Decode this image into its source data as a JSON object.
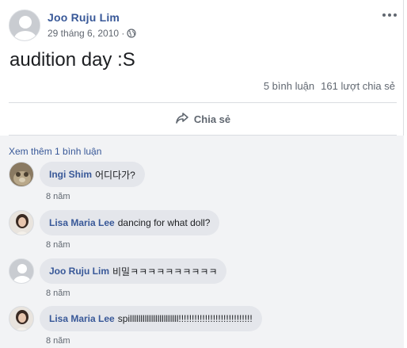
{
  "post": {
    "author": "Joo Ruju Lim",
    "date": "29 tháng 6, 2010 ·",
    "privacy_icon": "globe-icon",
    "text": "audition day :S",
    "stats": {
      "comments": "5 bình luận",
      "shares": "161 lượt chia sẻ"
    },
    "share_label": "Chia sẻ"
  },
  "comments": {
    "view_more": "Xem thêm 1 bình luận",
    "items": [
      {
        "name": "Ingi Shim",
        "text": "어디다가?",
        "time": "8 năm"
      },
      {
        "name": "Lisa Maria Lee",
        "text": "dancing for what doll?",
        "time": "8 năm"
      },
      {
        "name": "Joo Ruju Lim",
        "text": "비밀ㅋㅋㅋㅋㅋㅋㅋㅋㅋㅋ",
        "time": "8 năm"
      },
      {
        "name": "Lisa Maria Lee",
        "text": "spilllllllllllllllllllllll!!!!!!!!!!!!!!!!!!!!!!!!!!!!",
        "time": "8 năm"
      }
    ]
  },
  "colors": {
    "link": "#385898",
    "meta": "#606770",
    "bubble": "#e4e6eb",
    "comments_bg": "#f2f3f5"
  }
}
